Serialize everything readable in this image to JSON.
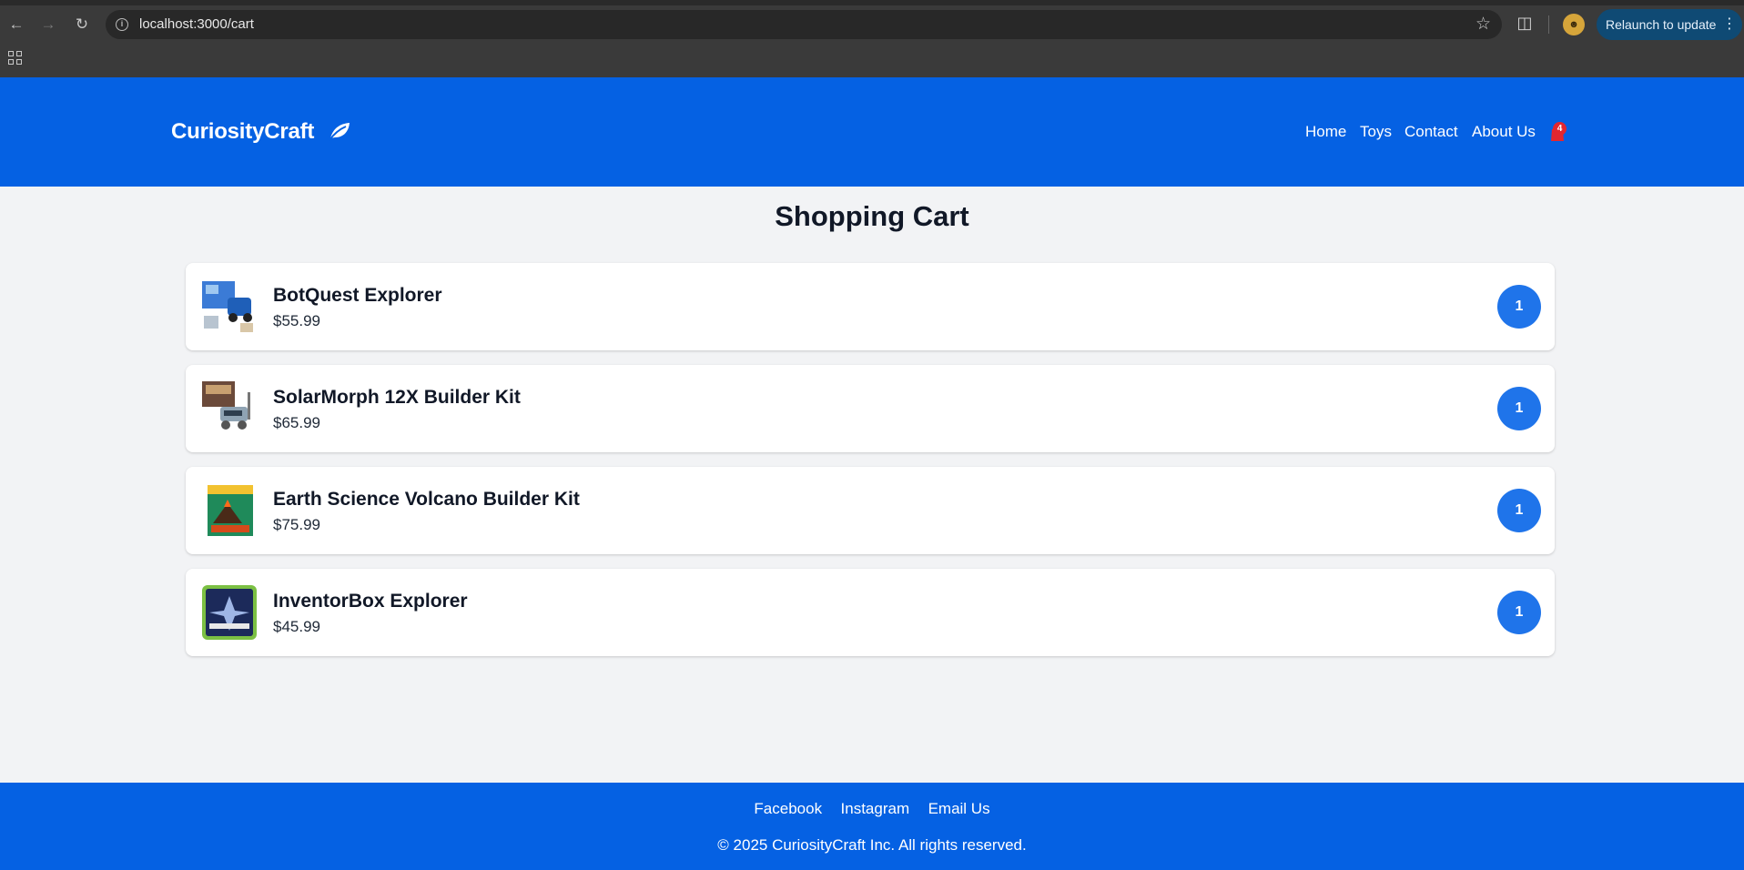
{
  "browser": {
    "url": "localhost:3000/cart",
    "relaunch_label": "Relaunch to update"
  },
  "header": {
    "brand": "CuriosityCraft",
    "nav": [
      {
        "label": "Home"
      },
      {
        "label": "Toys"
      },
      {
        "label": "Contact"
      },
      {
        "label": "About Us"
      }
    ],
    "cart_count": "4"
  },
  "main": {
    "title": "Shopping Cart",
    "items": [
      {
        "name": "BotQuest Explorer",
        "price": "$55.99",
        "quantity": "1"
      },
      {
        "name": "SolarMorph 12X Builder Kit",
        "price": "$65.99",
        "quantity": "1"
      },
      {
        "name": "Earth Science Volcano Builder Kit",
        "price": "$75.99",
        "quantity": "1"
      },
      {
        "name": "InventorBox Explorer",
        "price": "$45.99",
        "quantity": "1"
      }
    ]
  },
  "footer": {
    "links": [
      {
        "label": "Facebook"
      },
      {
        "label": "Instagram"
      },
      {
        "label": "Email Us"
      }
    ],
    "copyright": "© 2025 CuriosityCraft Inc. All rights reserved."
  },
  "colors": {
    "brand_blue": "#0561e3",
    "quantity_blue": "#1f74ea",
    "badge_red": "#e3262f",
    "page_bg": "#f2f3f5"
  }
}
